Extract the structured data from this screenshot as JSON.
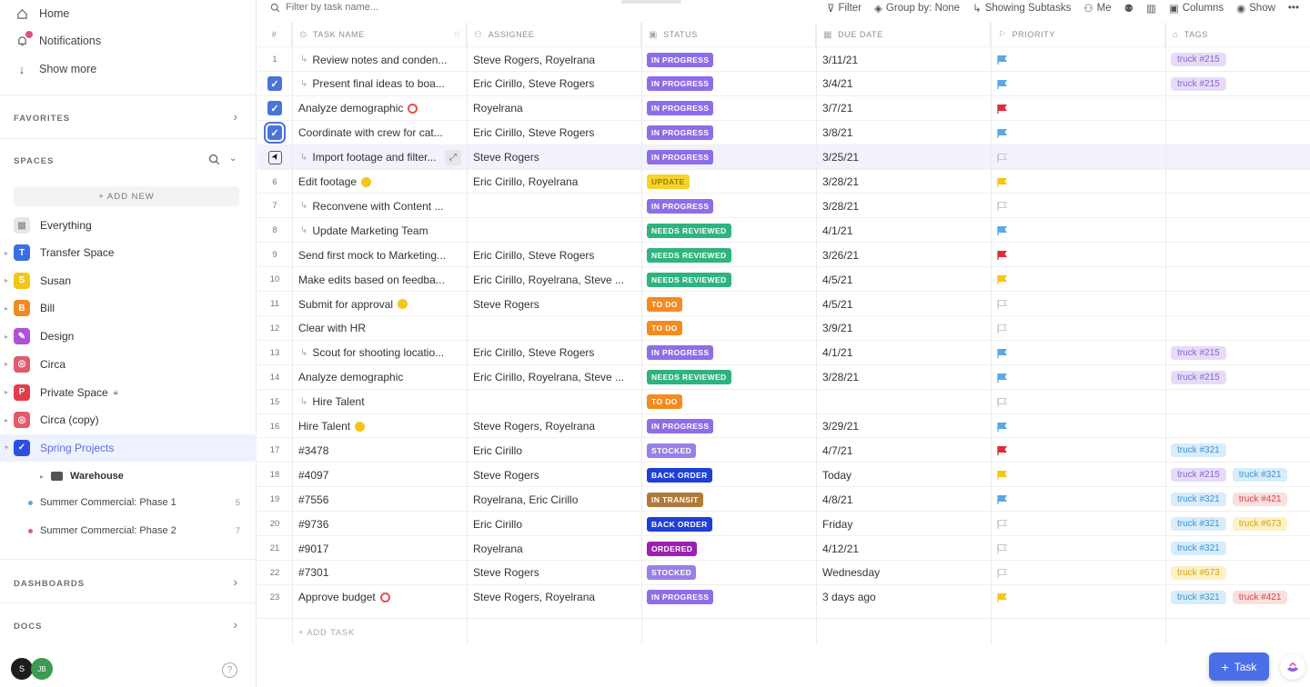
{
  "sidebar": {
    "nav": [
      {
        "label": "Home",
        "icon": "home-icon"
      },
      {
        "label": "Notifications",
        "icon": "bell-icon"
      },
      {
        "label": "Show more",
        "icon": "arrow-down-icon"
      }
    ],
    "favorites_title": "FAVORITES",
    "spaces_title": "SPACES",
    "add_new": "+ ADD NEW",
    "everything": "Everything",
    "spaces": [
      {
        "label": "Transfer Space",
        "letter": "T",
        "color": "#3b6de8"
      },
      {
        "label": "Susan",
        "letter": "S",
        "color": "#f5c518"
      },
      {
        "label": "Bill",
        "letter": "B",
        "color": "#f08a24"
      },
      {
        "label": "Design",
        "letter": "✎",
        "color": "#b150d8"
      },
      {
        "label": "Circa",
        "letter": "◎",
        "color": "#e35a6a"
      },
      {
        "label": "Private Space",
        "letter": "P",
        "color": "#e23d4d"
      },
      {
        "label": "Circa (copy)",
        "letter": "◎",
        "color": "#e35a6a"
      },
      {
        "label": "Spring Projects",
        "letter": "✓",
        "color": "#2b4fe0"
      }
    ],
    "folder": "Warehouse",
    "lists": [
      {
        "label": "Summer Commercial: Phase 1",
        "count": "5",
        "dot": "#5aa8e6"
      },
      {
        "label": "Summer Commercial: Phase 2",
        "count": "7",
        "dot": "#e35a6a"
      }
    ],
    "dashboards_title": "DASHBOARDS",
    "docs_title": "DOCS",
    "avatars": [
      {
        "initials": "S",
        "color": "#1d1d1f"
      },
      {
        "initials": "JB",
        "color": "#3c9a52"
      }
    ]
  },
  "toolbar": {
    "search_placeholder": "Filter by task name...",
    "filter": "Filter",
    "group_by": "Group by: None",
    "subtasks": "Showing Subtasks",
    "me": "Me",
    "columns": "Columns",
    "show": "Show"
  },
  "columns": {
    "num": "#",
    "name": "TASK NAME",
    "assignee": "ASSIGNEE",
    "status": "STATUS",
    "due": "DUE DATE",
    "priority": "PRIORITY",
    "tags": "TAGS"
  },
  "rows": [
    {
      "num": "1",
      "name": "Review notes and conden...",
      "sub": true,
      "assignee": "Steve Rogers, Royelrana",
      "status": "IN PROGRESS",
      "status_color": "#8e6ee8",
      "due": "3/11/21",
      "priority": "#5aa8e6",
      "tags": [
        {
          "label": "truck #215",
          "bg": "#e6dcf8",
          "fg": "#8a62d6"
        }
      ]
    },
    {
      "num": "",
      "check": "checked",
      "name": "Present final ideas to boa...",
      "sub": true,
      "assignee": "Eric Cirillo, Steve Rogers",
      "status": "IN PROGRESS",
      "status_color": "#8e6ee8",
      "due": "3/4/21",
      "priority": "#5aa8e6",
      "tags": [
        {
          "label": "truck #215",
          "bg": "#e6dcf8",
          "fg": "#8a62d6"
        }
      ]
    },
    {
      "num": "",
      "check": "checked",
      "name": "Analyze demographic",
      "sub": false,
      "icon": "#e84d4d",
      "assignee": "Royelrana",
      "status": "IN PROGRESS",
      "status_color": "#8e6ee8",
      "due": "3/7/21",
      "priority": "#e02b3c",
      "tags": []
    },
    {
      "num": "",
      "check": "focused",
      "name": "Coordinate with crew for cat...",
      "sub": false,
      "assignee": "Eric Cirillo, Steve Rogers",
      "status": "IN PROGRESS",
      "status_color": "#8e6ee8",
      "due": "3/8/21",
      "priority": "#5aa8e6",
      "tags": []
    },
    {
      "num": "",
      "check": "partial",
      "name": "Import footage and filter...",
      "sub": true,
      "hl": true,
      "assignee": "Steve Rogers",
      "status": "IN PROGRESS",
      "status_color": "#8e6ee8",
      "due": "3/25/21",
      "priority": "#dddddd",
      "tags": []
    },
    {
      "num": "6",
      "name": "Edit footage",
      "sub": false,
      "icon": "#f5c518",
      "assignee": "Eric Cirillo, Royelrana",
      "status": "UPDATE",
      "status_color": "#f5d32a",
      "status_fg": "#9a7a00",
      "due": "3/28/21",
      "priority": "#f5c518",
      "tags": []
    },
    {
      "num": "7",
      "name": "Reconvene with Content ...",
      "sub": true,
      "assignee": "",
      "status": "IN PROGRESS",
      "status_color": "#8e6ee8",
      "due": "3/28/21",
      "priority": "#dddddd",
      "tags": []
    },
    {
      "num": "8",
      "name": "Update Marketing Team",
      "sub": true,
      "assignee": "",
      "status": "NEEDS REVIEWED",
      "status_color": "#2fb37f",
      "due": "4/1/21",
      "priority": "#5aa8e6",
      "tags": []
    },
    {
      "num": "9",
      "name": "Send first mock to Marketing...",
      "sub": false,
      "assignee": "Eric Cirillo, Steve Rogers",
      "status": "NEEDS REVIEWED",
      "status_color": "#2fb37f",
      "due": "3/26/21",
      "priority": "#e02b3c",
      "tags": []
    },
    {
      "num": "10",
      "name": "Make edits based on feedba...",
      "sub": false,
      "assignee": "Eric Cirillo, Royelrana, Steve ...",
      "status": "NEEDS REVIEWED",
      "status_color": "#2fb37f",
      "due": "4/5/21",
      "priority": "#f5c518",
      "tags": []
    },
    {
      "num": "11",
      "name": "Submit for approval",
      "sub": false,
      "icon": "#f5c518",
      "assignee": "Steve Rogers",
      "status": "TO DO",
      "status_color": "#f58a1f",
      "due": "4/5/21",
      "priority": "#dddddd",
      "tags": []
    },
    {
      "num": "12",
      "name": "Clear with HR",
      "sub": false,
      "assignee": "",
      "status": "TO DO",
      "status_color": "#f58a1f",
      "due": "3/9/21",
      "priority": "#dddddd",
      "tags": []
    },
    {
      "num": "13",
      "name": "Scout for shooting locatio...",
      "sub": true,
      "assignee": "Eric Cirillo, Steve Rogers",
      "status": "IN PROGRESS",
      "status_color": "#8e6ee8",
      "due": "4/1/21",
      "priority": "#5aa8e6",
      "tags": [
        {
          "label": "truck #215",
          "bg": "#e6dcf8",
          "fg": "#8a62d6"
        }
      ]
    },
    {
      "num": "14",
      "name": "Analyze demographic",
      "sub": false,
      "assignee": "Eric Cirillo, Royelrana, Steve ...",
      "status": "NEEDS REVIEWED",
      "status_color": "#2fb37f",
      "due": "3/28/21",
      "priority": "#5aa8e6",
      "tags": [
        {
          "label": "truck #215",
          "bg": "#e6dcf8",
          "fg": "#8a62d6"
        }
      ]
    },
    {
      "num": "15",
      "name": "Hire Talent",
      "sub": true,
      "assignee": "",
      "status": "TO DO",
      "status_color": "#f58a1f",
      "due": "",
      "priority": "#dddddd",
      "tags": []
    },
    {
      "num": "16",
      "name": "Hire Talent",
      "sub": false,
      "icon": "#f5c518",
      "assignee": "Steve Rogers, Royelrana",
      "status": "IN PROGRESS",
      "status_color": "#8e6ee8",
      "due": "3/29/21",
      "priority": "#5aa8e6",
      "tags": []
    },
    {
      "num": "17",
      "name": "#3478",
      "sub": false,
      "assignee": "Eric Cirillo",
      "status": "STOCKED",
      "status_color": "#9a7fe8",
      "due": "4/7/21",
      "priority": "#e02b3c",
      "tags": [
        {
          "label": "truck #321",
          "bg": "#d8ecfa",
          "fg": "#3a95d8"
        }
      ]
    },
    {
      "num": "18",
      "name": "#4097",
      "sub": false,
      "assignee": "Steve Rogers",
      "status": "BACK ORDER",
      "status_color": "#1f3fd6",
      "due": "Today",
      "priority": "#f5c518",
      "tags": [
        {
          "label": "truck #215",
          "bg": "#e6dcf8",
          "fg": "#8a62d6"
        },
        {
          "label": "truck #321",
          "bg": "#d8ecfa",
          "fg": "#3a95d8"
        }
      ]
    },
    {
      "num": "19",
      "name": "#7556",
      "sub": false,
      "assignee": "Royelrana, Eric Cirillo",
      "status": "IN TRANSIT",
      "status_color": "#b07a3a",
      "due": "4/8/21",
      "priority": "#5aa8e6",
      "tags": [
        {
          "label": "truck #321",
          "bg": "#d8ecfa",
          "fg": "#3a95d8"
        },
        {
          "label": "truck #421",
          "bg": "#fbdede",
          "fg": "#d84646"
        }
      ]
    },
    {
      "num": "20",
      "name": "#9736",
      "sub": false,
      "assignee": "Eric Cirillo",
      "status": "BACK ORDER",
      "status_color": "#1f3fd6",
      "due": "Friday",
      "priority": "#dddddd",
      "tags": [
        {
          "label": "truck #321",
          "bg": "#d8ecfa",
          "fg": "#3a95d8"
        },
        {
          "label": "truck #673",
          "bg": "#fdf1c6",
          "fg": "#d2a413"
        }
      ]
    },
    {
      "num": "21",
      "name": "#9017",
      "sub": false,
      "assignee": "Royelrana",
      "status": "ORDERED",
      "status_color": "#9d1fb3",
      "due": "4/12/21",
      "priority": "#dddddd",
      "tags": [
        {
          "label": "truck #321",
          "bg": "#d8ecfa",
          "fg": "#3a95d8"
        }
      ]
    },
    {
      "num": "22",
      "name": "#7301",
      "sub": false,
      "assignee": "Steve Rogers",
      "status": "STOCKED",
      "status_color": "#9a7fe8",
      "due": "Wednesday",
      "priority": "#dddddd",
      "tags": [
        {
          "label": "truck #673",
          "bg": "#fdf1c6",
          "fg": "#d2a413"
        }
      ]
    },
    {
      "num": "23",
      "name": "Approve budget",
      "sub": false,
      "icon": "#e84d4d",
      "assignee": "Steve Rogers, Royelrana",
      "status": "IN PROGRESS",
      "status_color": "#8e6ee8",
      "due": "3 days ago",
      "priority": "#f5c518",
      "tags": [
        {
          "label": "truck #321",
          "bg": "#d8ecfa",
          "fg": "#3a95d8"
        },
        {
          "label": "truck #421",
          "bg": "#fbdede",
          "fg": "#d84646"
        }
      ]
    }
  ],
  "add_task": "+ ADD TASK",
  "fab_label": "Task"
}
